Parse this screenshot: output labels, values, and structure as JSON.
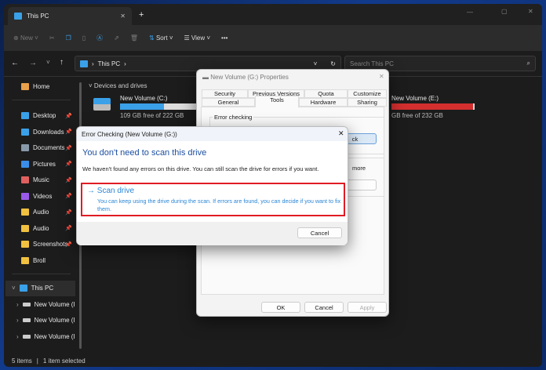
{
  "window": {
    "tab_title": "This PC",
    "new_tab": "+",
    "close_tab": "✕",
    "minimize": "—",
    "maximize": "▢",
    "close": "✕"
  },
  "toolbar": {
    "new": "New",
    "sort": "Sort",
    "view": "View",
    "more": "•••"
  },
  "address": {
    "path": "This PC",
    "search_placeholder": "Search This PC"
  },
  "sidebar": {
    "home": "Home",
    "items": [
      {
        "label": "Desktop",
        "color": "#3aa0e8"
      },
      {
        "label": "Downloads",
        "color": "#3aa0e8"
      },
      {
        "label": "Documents",
        "color": "#8899aa"
      },
      {
        "label": "Pictures",
        "color": "#3a8ee8"
      },
      {
        "label": "Music",
        "color": "#e06060"
      },
      {
        "label": "Videos",
        "color": "#9a5ae8"
      },
      {
        "label": "Audio",
        "color": "#f0c040"
      },
      {
        "label": "Audio",
        "color": "#f0c040"
      },
      {
        "label": "Screenshots",
        "color": "#f0c040"
      },
      {
        "label": "Broll",
        "color": "#f0c040"
      }
    ],
    "this_pc": "This PC",
    "volumes": [
      "New Volume (I",
      "New Volume (I",
      "New Volume (I"
    ]
  },
  "content": {
    "section": "Devices and drives",
    "drives": [
      {
        "name": "New Volume (C:)",
        "free": "109 GB free of 222 GB",
        "used_fraction": 0.51,
        "color": "#3aa0e8"
      },
      {
        "name": "New Volume (E:)",
        "free": "GB free of 232 GB",
        "used_fraction": 0.98,
        "color": "#d32f2f"
      }
    ]
  },
  "status": {
    "items": "5 items",
    "selected": "1 item selected"
  },
  "properties": {
    "title": "New Volume (G:) Properties",
    "tabs_row1": [
      "Security",
      "Previous Versions",
      "Quota",
      "Customize"
    ],
    "tabs_row2": [
      "General",
      "Tools",
      "Hardware",
      "Sharing"
    ],
    "group1": "Error checking",
    "check_btn": "ck",
    "more_text": "more",
    "ok": "OK",
    "cancel": "Cancel",
    "apply": "Apply"
  },
  "error_dialog": {
    "title": "Error Checking (New Volume (G:))",
    "heading": "You don't need to scan this drive",
    "message": "We haven't found any errors on this drive. You can still scan the drive for errors if you want.",
    "scan_title": "Scan drive",
    "scan_desc": "You can keep using the drive during the scan. If errors are found, you can decide if you want to fix them.",
    "cancel": "Cancel"
  }
}
